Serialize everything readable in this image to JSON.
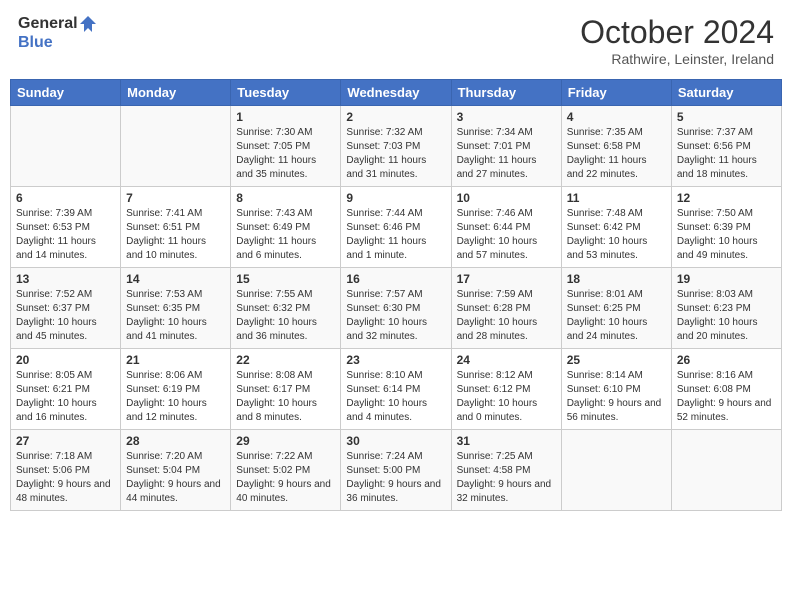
{
  "header": {
    "logo_line1": "General",
    "logo_line2": "Blue",
    "month_title": "October 2024",
    "location": "Rathwire, Leinster, Ireland"
  },
  "days_of_week": [
    "Sunday",
    "Monday",
    "Tuesday",
    "Wednesday",
    "Thursday",
    "Friday",
    "Saturday"
  ],
  "weeks": [
    [
      {
        "day": "",
        "info": ""
      },
      {
        "day": "",
        "info": ""
      },
      {
        "day": "1",
        "info": "Sunrise: 7:30 AM\nSunset: 7:05 PM\nDaylight: 11 hours and 35 minutes."
      },
      {
        "day": "2",
        "info": "Sunrise: 7:32 AM\nSunset: 7:03 PM\nDaylight: 11 hours and 31 minutes."
      },
      {
        "day": "3",
        "info": "Sunrise: 7:34 AM\nSunset: 7:01 PM\nDaylight: 11 hours and 27 minutes."
      },
      {
        "day": "4",
        "info": "Sunrise: 7:35 AM\nSunset: 6:58 PM\nDaylight: 11 hours and 22 minutes."
      },
      {
        "day": "5",
        "info": "Sunrise: 7:37 AM\nSunset: 6:56 PM\nDaylight: 11 hours and 18 minutes."
      }
    ],
    [
      {
        "day": "6",
        "info": "Sunrise: 7:39 AM\nSunset: 6:53 PM\nDaylight: 11 hours and 14 minutes."
      },
      {
        "day": "7",
        "info": "Sunrise: 7:41 AM\nSunset: 6:51 PM\nDaylight: 11 hours and 10 minutes."
      },
      {
        "day": "8",
        "info": "Sunrise: 7:43 AM\nSunset: 6:49 PM\nDaylight: 11 hours and 6 minutes."
      },
      {
        "day": "9",
        "info": "Sunrise: 7:44 AM\nSunset: 6:46 PM\nDaylight: 11 hours and 1 minute."
      },
      {
        "day": "10",
        "info": "Sunrise: 7:46 AM\nSunset: 6:44 PM\nDaylight: 10 hours and 57 minutes."
      },
      {
        "day": "11",
        "info": "Sunrise: 7:48 AM\nSunset: 6:42 PM\nDaylight: 10 hours and 53 minutes."
      },
      {
        "day": "12",
        "info": "Sunrise: 7:50 AM\nSunset: 6:39 PM\nDaylight: 10 hours and 49 minutes."
      }
    ],
    [
      {
        "day": "13",
        "info": "Sunrise: 7:52 AM\nSunset: 6:37 PM\nDaylight: 10 hours and 45 minutes."
      },
      {
        "day": "14",
        "info": "Sunrise: 7:53 AM\nSunset: 6:35 PM\nDaylight: 10 hours and 41 minutes."
      },
      {
        "day": "15",
        "info": "Sunrise: 7:55 AM\nSunset: 6:32 PM\nDaylight: 10 hours and 36 minutes."
      },
      {
        "day": "16",
        "info": "Sunrise: 7:57 AM\nSunset: 6:30 PM\nDaylight: 10 hours and 32 minutes."
      },
      {
        "day": "17",
        "info": "Sunrise: 7:59 AM\nSunset: 6:28 PM\nDaylight: 10 hours and 28 minutes."
      },
      {
        "day": "18",
        "info": "Sunrise: 8:01 AM\nSunset: 6:25 PM\nDaylight: 10 hours and 24 minutes."
      },
      {
        "day": "19",
        "info": "Sunrise: 8:03 AM\nSunset: 6:23 PM\nDaylight: 10 hours and 20 minutes."
      }
    ],
    [
      {
        "day": "20",
        "info": "Sunrise: 8:05 AM\nSunset: 6:21 PM\nDaylight: 10 hours and 16 minutes."
      },
      {
        "day": "21",
        "info": "Sunrise: 8:06 AM\nSunset: 6:19 PM\nDaylight: 10 hours and 12 minutes."
      },
      {
        "day": "22",
        "info": "Sunrise: 8:08 AM\nSunset: 6:17 PM\nDaylight: 10 hours and 8 minutes."
      },
      {
        "day": "23",
        "info": "Sunrise: 8:10 AM\nSunset: 6:14 PM\nDaylight: 10 hours and 4 minutes."
      },
      {
        "day": "24",
        "info": "Sunrise: 8:12 AM\nSunset: 6:12 PM\nDaylight: 10 hours and 0 minutes."
      },
      {
        "day": "25",
        "info": "Sunrise: 8:14 AM\nSunset: 6:10 PM\nDaylight: 9 hours and 56 minutes."
      },
      {
        "day": "26",
        "info": "Sunrise: 8:16 AM\nSunset: 6:08 PM\nDaylight: 9 hours and 52 minutes."
      }
    ],
    [
      {
        "day": "27",
        "info": "Sunrise: 7:18 AM\nSunset: 5:06 PM\nDaylight: 9 hours and 48 minutes."
      },
      {
        "day": "28",
        "info": "Sunrise: 7:20 AM\nSunset: 5:04 PM\nDaylight: 9 hours and 44 minutes."
      },
      {
        "day": "29",
        "info": "Sunrise: 7:22 AM\nSunset: 5:02 PM\nDaylight: 9 hours and 40 minutes."
      },
      {
        "day": "30",
        "info": "Sunrise: 7:24 AM\nSunset: 5:00 PM\nDaylight: 9 hours and 36 minutes."
      },
      {
        "day": "31",
        "info": "Sunrise: 7:25 AM\nSunset: 4:58 PM\nDaylight: 9 hours and 32 minutes."
      },
      {
        "day": "",
        "info": ""
      },
      {
        "day": "",
        "info": ""
      }
    ]
  ]
}
